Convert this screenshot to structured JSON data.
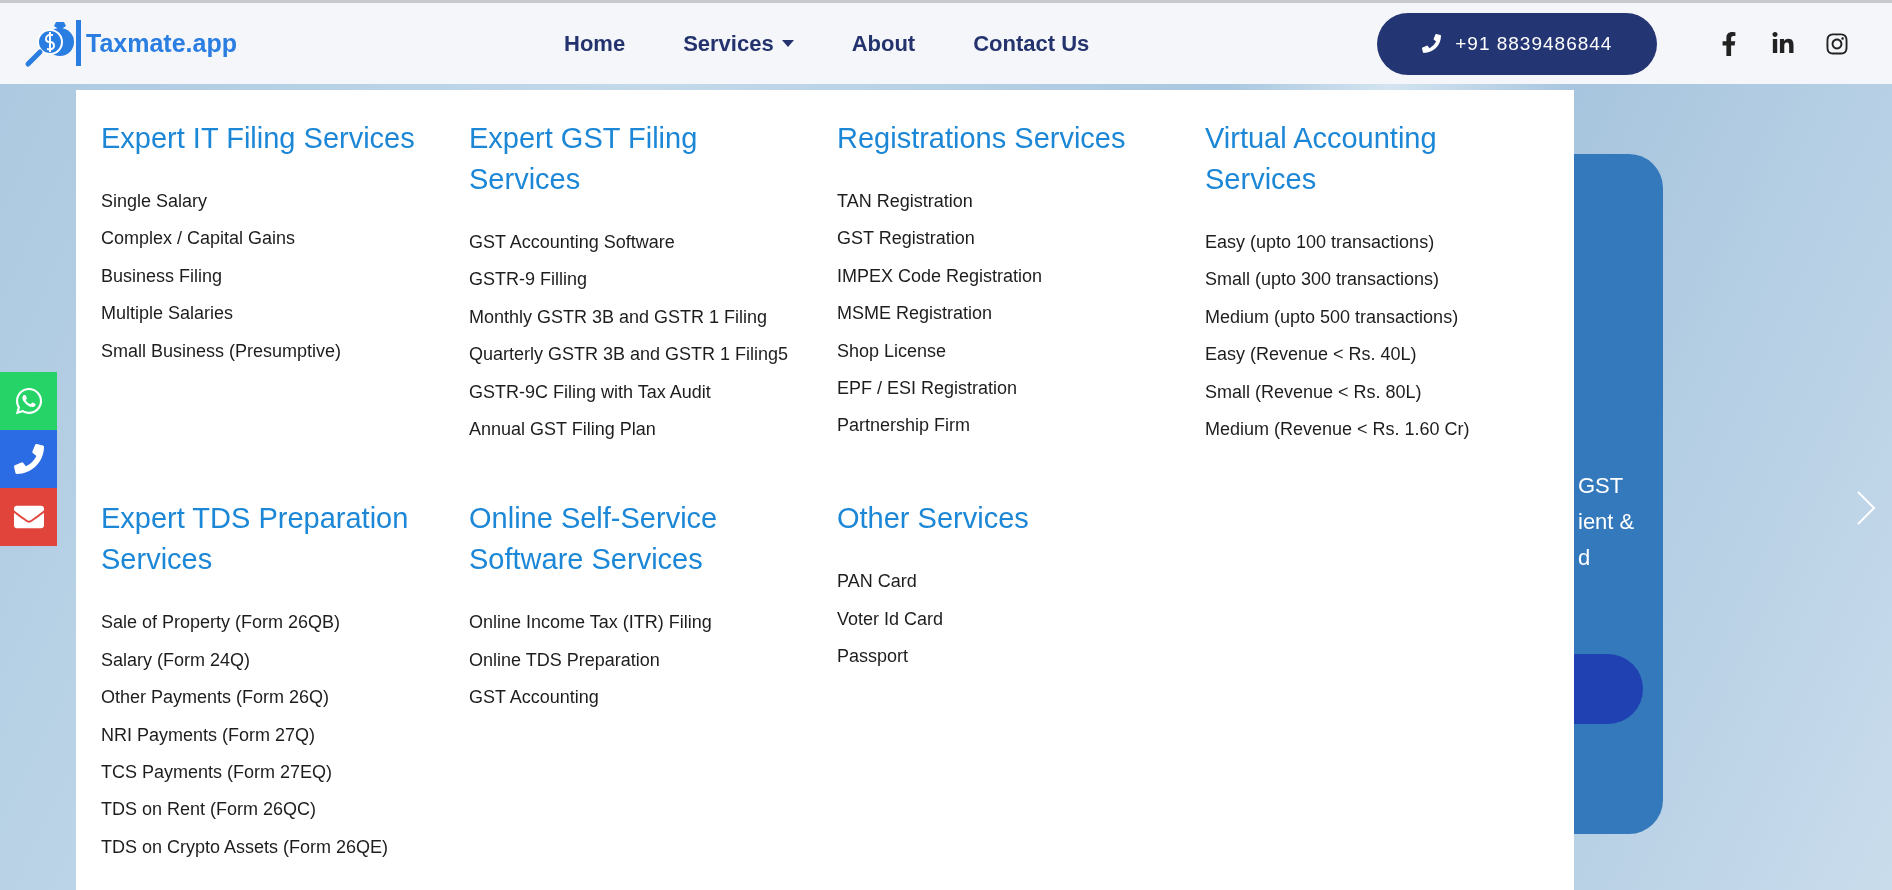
{
  "header": {
    "logo": "Taxmate.app",
    "nav": [
      {
        "label": "Home",
        "dropdown": false
      },
      {
        "label": "Services",
        "dropdown": true
      },
      {
        "label": "About",
        "dropdown": false
      },
      {
        "label": "Contact Us",
        "dropdown": false
      }
    ],
    "phone_button": "+91 8839486844"
  },
  "mega_menu": {
    "sections": [
      {
        "title": "Expert IT Filing Services",
        "items": [
          "Single Salary",
          "Complex / Capital Gains",
          "Business Filing",
          "Multiple Salaries",
          "Small Business (Presumptive)"
        ]
      },
      {
        "title": "Expert GST Filing Services",
        "items": [
          "GST Accounting Software",
          "GSTR-9 Filling",
          "Monthly GSTR 3B and GSTR 1 Filing",
          "Quarterly GSTR 3B and GSTR 1 Filing5",
          "GSTR-9C Filing with Tax Audit",
          "Annual GST Filing Plan"
        ]
      },
      {
        "title": "Registrations Services",
        "items": [
          "TAN Registration",
          "GST Registration",
          "IMPEX Code Registration",
          "MSME Registration",
          "Shop License",
          "EPF / ESI Registration",
          "Partnership Firm"
        ]
      },
      {
        "title": "Virtual Accounting Services",
        "items": [
          "Easy (upto 100 transactions)",
          "Small (upto 300 transactions)",
          "Medium (upto 500 transactions)",
          "Easy (Revenue < Rs. 40L)",
          "Small (Revenue < Rs. 80L)",
          "Medium (Revenue < Rs. 1.60 Cr)"
        ]
      },
      {
        "title": "Expert TDS Preparation Services",
        "items": [
          "Sale of Property (Form 26QB)",
          "Salary (Form 24Q)",
          "Other Payments (Form 26Q)",
          "NRI Payments (Form 27Q)",
          "TCS Payments (Form 27EQ)",
          "TDS on Rent (Form 26QC)",
          "TDS on Crypto Assets (Form 26QE)"
        ]
      },
      {
        "title": "Online Self-Service Software Services",
        "items": [
          "Online Income Tax (ITR) Filing",
          "Online TDS Preparation",
          "GST Accounting"
        ]
      },
      {
        "title": "Other Services",
        "items": [
          "PAN Card",
          "Voter Id Card",
          "Passport"
        ]
      }
    ]
  },
  "hero": {
    "text_lines": [
      "GST",
      "ient &",
      "d"
    ]
  },
  "side_contacts": [
    {
      "kind": "whatsapp",
      "color": "#25d366"
    },
    {
      "kind": "phone",
      "color": "#2b6be3"
    },
    {
      "kind": "email",
      "color": "#e0443a"
    }
  ]
}
